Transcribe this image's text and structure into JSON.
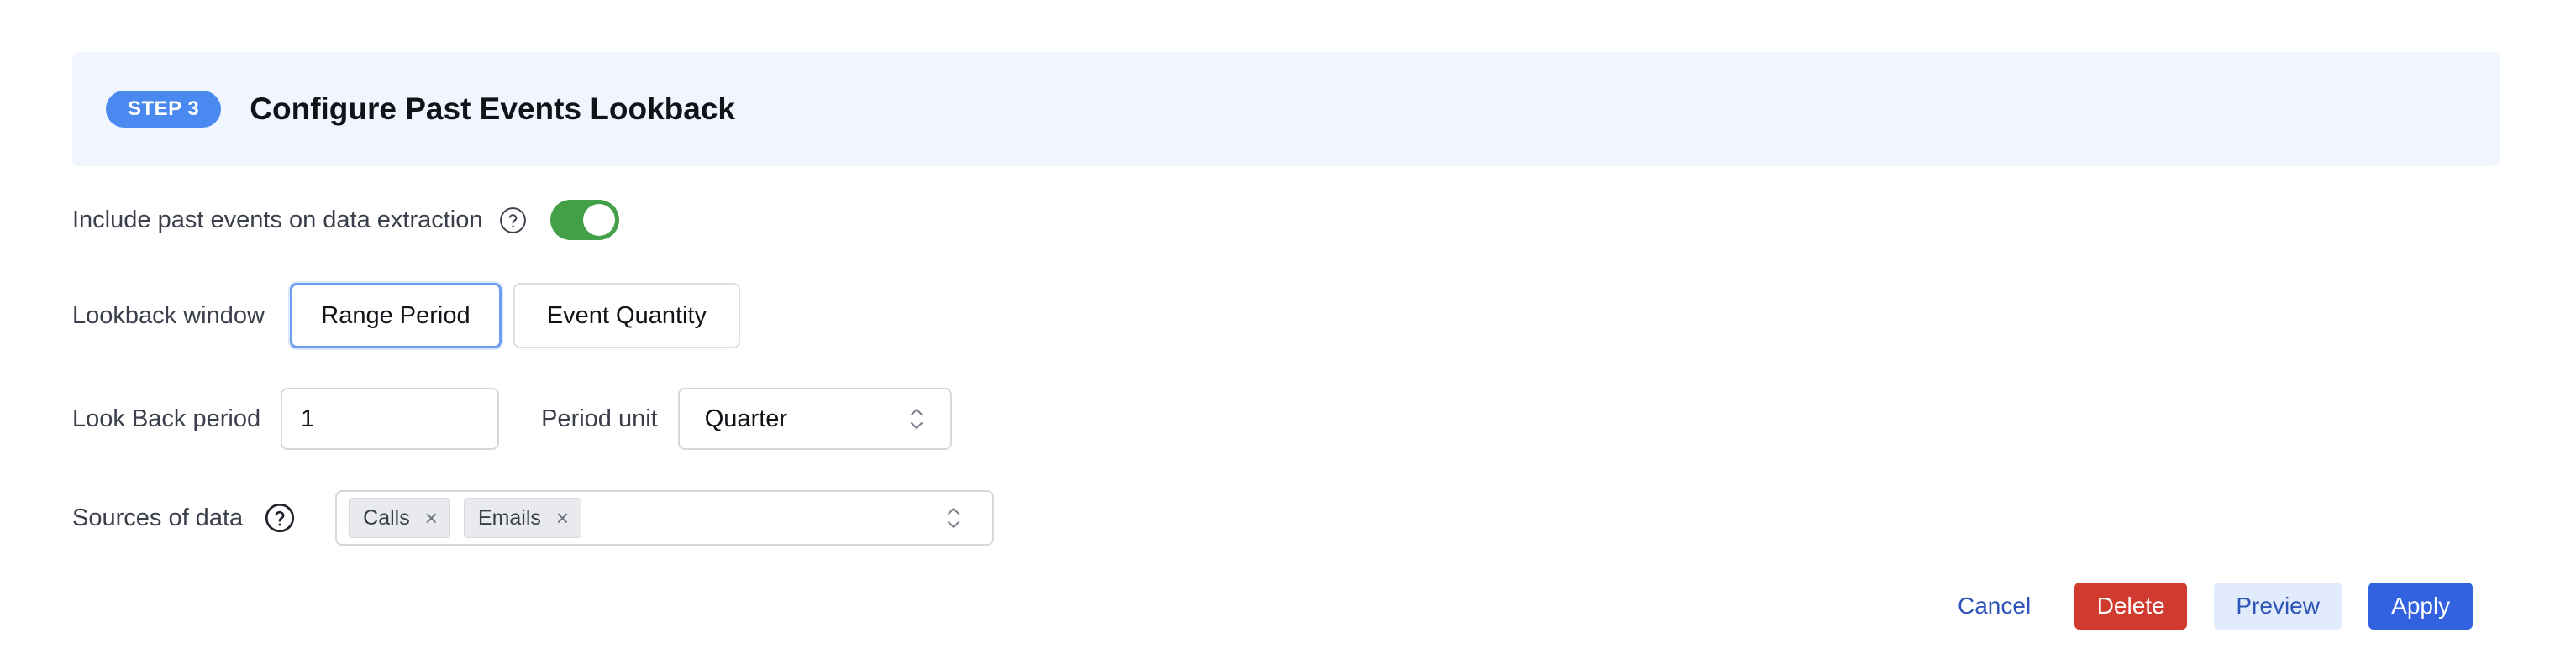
{
  "header": {
    "step_badge": "STEP 3",
    "title": "Configure Past Events Lookback"
  },
  "include_past": {
    "label": "Include past events on data extraction",
    "enabled": true,
    "help_icon": "question-circle-icon"
  },
  "lookback_window": {
    "label": "Lookback window",
    "options": [
      "Range Period",
      "Event Quantity"
    ],
    "selected": "Range Period"
  },
  "look_back_period": {
    "label": "Look Back period",
    "value": "1"
  },
  "period_unit": {
    "label": "Period unit",
    "selected": "Quarter"
  },
  "sources": {
    "label": "Sources of data",
    "help_icon": "question-circle-icon",
    "chips": [
      "Calls",
      "Emails"
    ]
  },
  "footer": {
    "cancel_label": "Cancel",
    "delete_label": "Delete",
    "preview_label": "Preview",
    "apply_label": "Apply"
  },
  "colors": {
    "header_bg": "#f0f5fe",
    "badge": "#4a8af0",
    "toggle_on": "#43a047",
    "delete": "#d03a2f",
    "apply": "#3262e0",
    "preview_bg": "#e1ebfb",
    "link": "#2f55b8"
  }
}
